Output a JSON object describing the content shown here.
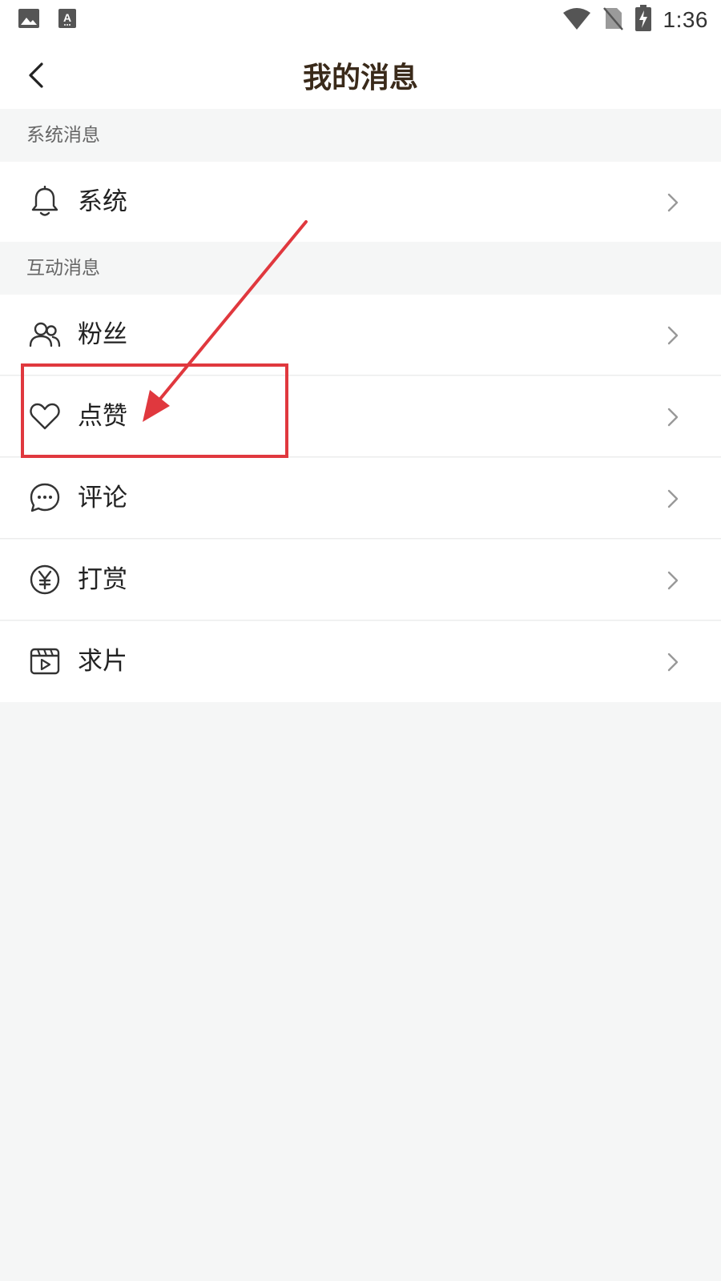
{
  "status_bar": {
    "time": "1:36",
    "left_icons": [
      "gallery-icon",
      "keyboard-a-icon"
    ],
    "right_icons": [
      "wifi-icon",
      "no-sim-icon",
      "battery-charging-icon"
    ]
  },
  "header": {
    "title": "我的消息",
    "back_icon": "chevron-left-icon"
  },
  "sections": [
    {
      "title": "系统消息",
      "items": [
        {
          "label": "系统",
          "icon": "bell-icon"
        }
      ]
    },
    {
      "title": "互动消息",
      "items": [
        {
          "label": "粉丝",
          "icon": "users-icon"
        },
        {
          "label": "点赞",
          "icon": "heart-icon"
        },
        {
          "label": "评论",
          "icon": "chat-bubble-icon"
        },
        {
          "label": "打赏",
          "icon": "yen-coin-icon"
        },
        {
          "label": "求片",
          "icon": "film-icon"
        }
      ]
    }
  ],
  "annotation": {
    "color": "#e0383e",
    "highlighted_item": "点赞"
  },
  "colors": {
    "background": "#f5f6f6",
    "row_background": "#ffffff",
    "title_color": "#3a2a1a",
    "annotation_red": "#e0383e"
  }
}
